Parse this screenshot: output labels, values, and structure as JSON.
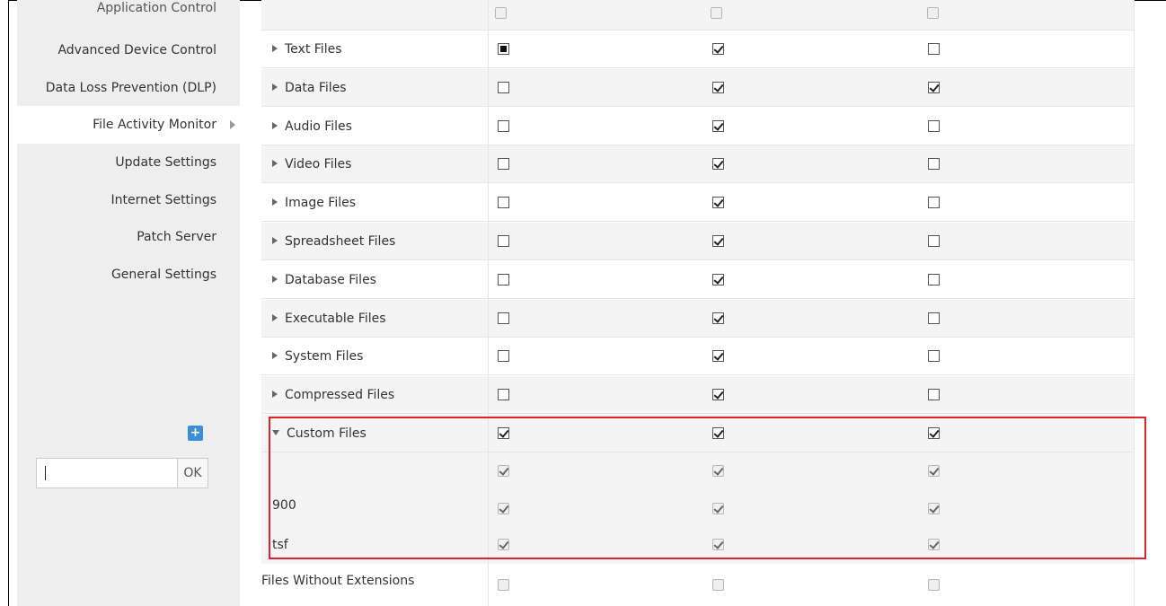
{
  "sidebar": {
    "items": [
      {
        "label": "Application Control"
      },
      {
        "label": "Advanced Device Control"
      },
      {
        "label": "Data Loss Prevention (DLP)"
      },
      {
        "label": "File Activity Monitor"
      },
      {
        "label": "Update Settings"
      },
      {
        "label": "Internet Settings"
      },
      {
        "label": "Patch Server"
      },
      {
        "label": "General Settings"
      }
    ],
    "active": "File Activity Monitor"
  },
  "rows": [
    {
      "label": "Text Files",
      "c1": "indeterminate",
      "c2": "checked",
      "c3": "unchecked"
    },
    {
      "label": "Data Files",
      "c1": "unchecked",
      "c2": "checked",
      "c3": "checked"
    },
    {
      "label": "Audio Files",
      "c1": "unchecked",
      "c2": "checked",
      "c3": "unchecked"
    },
    {
      "label": "Video Files",
      "c1": "unchecked",
      "c2": "checked",
      "c3": "unchecked"
    },
    {
      "label": "Image Files",
      "c1": "unchecked",
      "c2": "checked",
      "c3": "unchecked"
    },
    {
      "label": "Spreadsheet Files",
      "c1": "unchecked",
      "c2": "checked",
      "c3": "unchecked"
    },
    {
      "label": "Database Files",
      "c1": "unchecked",
      "c2": "checked",
      "c3": "unchecked"
    },
    {
      "label": "Executable Files",
      "c1": "unchecked",
      "c2": "checked",
      "c3": "unchecked"
    },
    {
      "label": "System Files",
      "c1": "unchecked",
      "c2": "checked",
      "c3": "unchecked"
    },
    {
      "label": "Compressed Files",
      "c1": "unchecked",
      "c2": "checked",
      "c3": "unchecked"
    }
  ],
  "custom": {
    "label": "Custom Files",
    "add_icon": "plus-icon",
    "input": {
      "value": "",
      "ok_label": "OK"
    },
    "entries": [
      {
        "label": "900"
      },
      {
        "label": "tsf"
      }
    ]
  },
  "no_ext": {
    "label": "Files Without Extensions"
  },
  "colors": {
    "highlight": "#e0202b",
    "add_button": "#3a8ed8"
  }
}
